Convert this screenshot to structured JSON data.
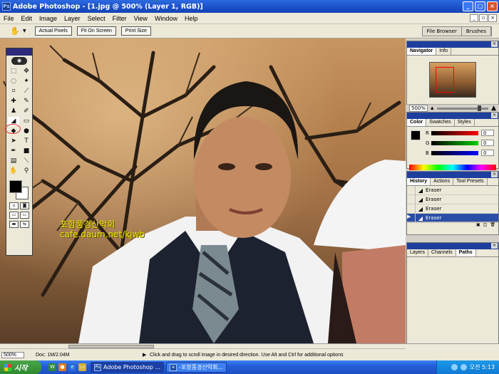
{
  "window": {
    "title": "Adobe Photoshop - [1.jpg @ 500% (Layer 1, RGB)]",
    "app_icon_text": "Ps"
  },
  "menu": [
    "File",
    "Edit",
    "Image",
    "Layer",
    "Select",
    "Filter",
    "View",
    "Window",
    "Help"
  ],
  "options": {
    "buttons": [
      "Actual Pixels",
      "Fit On Screen",
      "Print Size"
    ],
    "well_tabs": [
      "File Browser",
      "Brushes"
    ]
  },
  "canvas": {
    "watermark_line1": "포항풍경산악회",
    "watermark_line2": "cafe.daum.net/kjwb"
  },
  "navigator": {
    "tabs": [
      "Navigator",
      "Info"
    ],
    "zoom": "500%"
  },
  "color_panel": {
    "tabs": [
      "Color",
      "Swatches",
      "Styles"
    ],
    "channels": [
      {
        "label": "R",
        "value": "0"
      },
      {
        "label": "G",
        "value": "0"
      },
      {
        "label": "B",
        "value": "0"
      }
    ]
  },
  "history_panel": {
    "tabs": [
      "History",
      "Actions",
      "Tool Presets"
    ],
    "items": [
      "Eraser",
      "Eraser",
      "Eraser",
      "Eraser"
    ]
  },
  "layers_panel": {
    "tabs": [
      "Layers",
      "Channels",
      "Paths"
    ]
  },
  "status": {
    "zoom": "500%",
    "doc": "Doc: 1M/2.04M",
    "message": "Click and drag to scroll image in desired direction.  Use Alt and Ctrl for additional options"
  },
  "taskbar": {
    "start_label": "시작",
    "tasks": [
      "Adobe Photoshop ...",
      "-포항풍경산악회..."
    ],
    "clock": "오전 5:13"
  },
  "colors": {
    "titlebar": "#1a4fc8",
    "foreground": "#000000",
    "background": "#ffffff",
    "history_selected": "#2a4ea6"
  }
}
